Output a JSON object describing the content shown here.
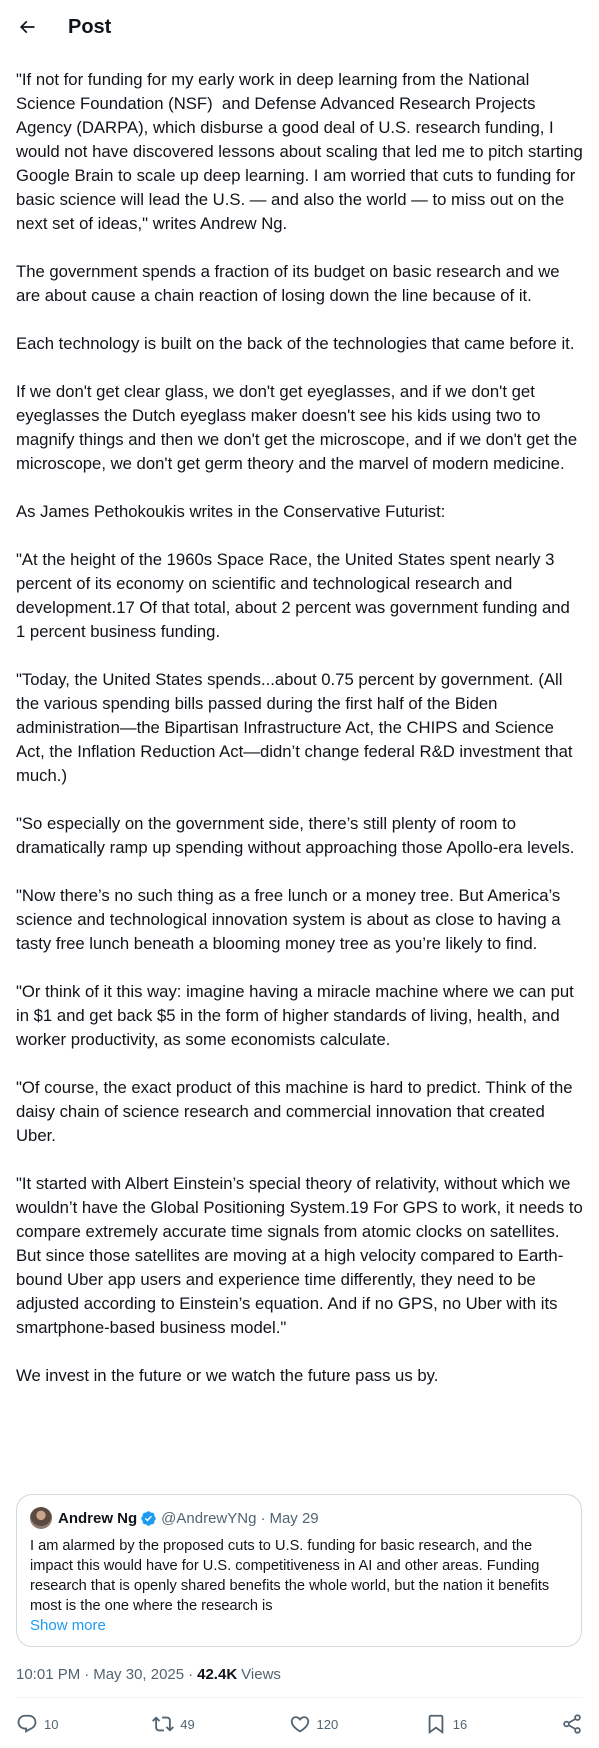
{
  "header": {
    "title": "Post"
  },
  "post": {
    "paragraphs": [
      "\"If not for funding for my early work in deep learning from the National Science Foundation (NSF)  and Defense Advanced Research Projects Agency (DARPA), which disburse a good deal of U.S. research funding, I would not have discovered lessons about scaling that led me to pitch starting Google Brain to scale up deep learning. I am worried that cuts to funding for basic science will lead the U.S. — and also the world — to miss out on the next set of ideas,\" writes Andrew Ng.",
      "The government spends a fraction of its budget on basic research and we are about cause a chain reaction of losing down the line because of it.",
      "Each technology is built on the back of the technologies that came before it.",
      "If we don't get clear glass, we don't get eyeglasses, and if we don't get eyeglasses the Dutch eyeglass maker doesn't see his kids using two to magnify things and then we don't get the microscope, and if we don't get the microscope, we don't get germ theory and the marvel of modern medicine.",
      "As James Pethokoukis writes in the Conservative Futurist:",
      "\"At the height of the 1960s Space Race, the United States spent nearly 3 percent of its economy on scientific and technological research and development.17 Of that total, about 2 percent was government funding and 1 percent business funding.",
      "\"Today, the United States spends...about 0.75 percent by government. (All the various spending bills passed during the first half of the Biden administration—the Bipartisan Infrastructure Act, the CHIPS and Science Act, the Inflation Reduction Act—didn’t change federal R&D investment that much.)",
      "\"So especially on the government side, there’s still plenty of room to dramatically ramp up spending without approaching those Apollo-era levels.",
      "\"Now there’s no such thing as a free lunch or a money tree. But America’s science and technological innovation system is about as close to having a tasty free lunch beneath a blooming money tree as you’re likely to find.",
      "\"Or think of it this way: imagine having a miracle machine where we can put in $1 and get back $5 in the form of higher standards of living, health, and worker productivity, as some economists calculate.",
      "\"Of course, the exact product of this machine is hard to predict. Think of the daisy chain of science research and commercial innovation that created Uber.",
      "\"It started with Albert Einstein’s special theory of relativity, without which we wouldn’t have the Global Positioning System.19 For GPS to work, it needs to compare extremely accurate time signals from atomic clocks on satellites. But since those satellites are moving at a high velocity compared to Earth-bound Uber app users and experience time differently, they need to be adjusted according to Einstein’s equation. And if no GPS, no Uber with its smartphone-based business model.\"",
      "We invest in the future or we watch the future pass us by."
    ],
    "quote": {
      "name": "Andrew Ng",
      "handle": "@AndrewYNg",
      "separator": "·",
      "date": "May 29",
      "text": "I am alarmed by the proposed cuts to U.S. funding for basic research, and the impact this would have for U.S. competitiveness in AI and other areas. Funding research that is openly shared benefits the whole world, but the nation it benefits most is the one where the research is",
      "show_more": "Show more"
    },
    "meta": {
      "time": "10:01 PM",
      "date": "May 30, 2025",
      "separator": "·",
      "views_count": "42.4K",
      "views_label": "Views"
    },
    "actions": {
      "replies": "10",
      "reposts": "49",
      "likes": "120",
      "bookmarks": "16"
    }
  },
  "icons": {
    "back": "arrow-left-icon",
    "verified": "verified-badge-icon",
    "reply": "reply-icon",
    "repost": "repost-icon",
    "like": "heart-icon",
    "bookmark": "bookmark-icon",
    "share": "share-icon"
  },
  "colors": {
    "accent": "#1d9bf0",
    "text": "#0f1419",
    "secondary": "#536471",
    "border": "#cfd9de"
  }
}
